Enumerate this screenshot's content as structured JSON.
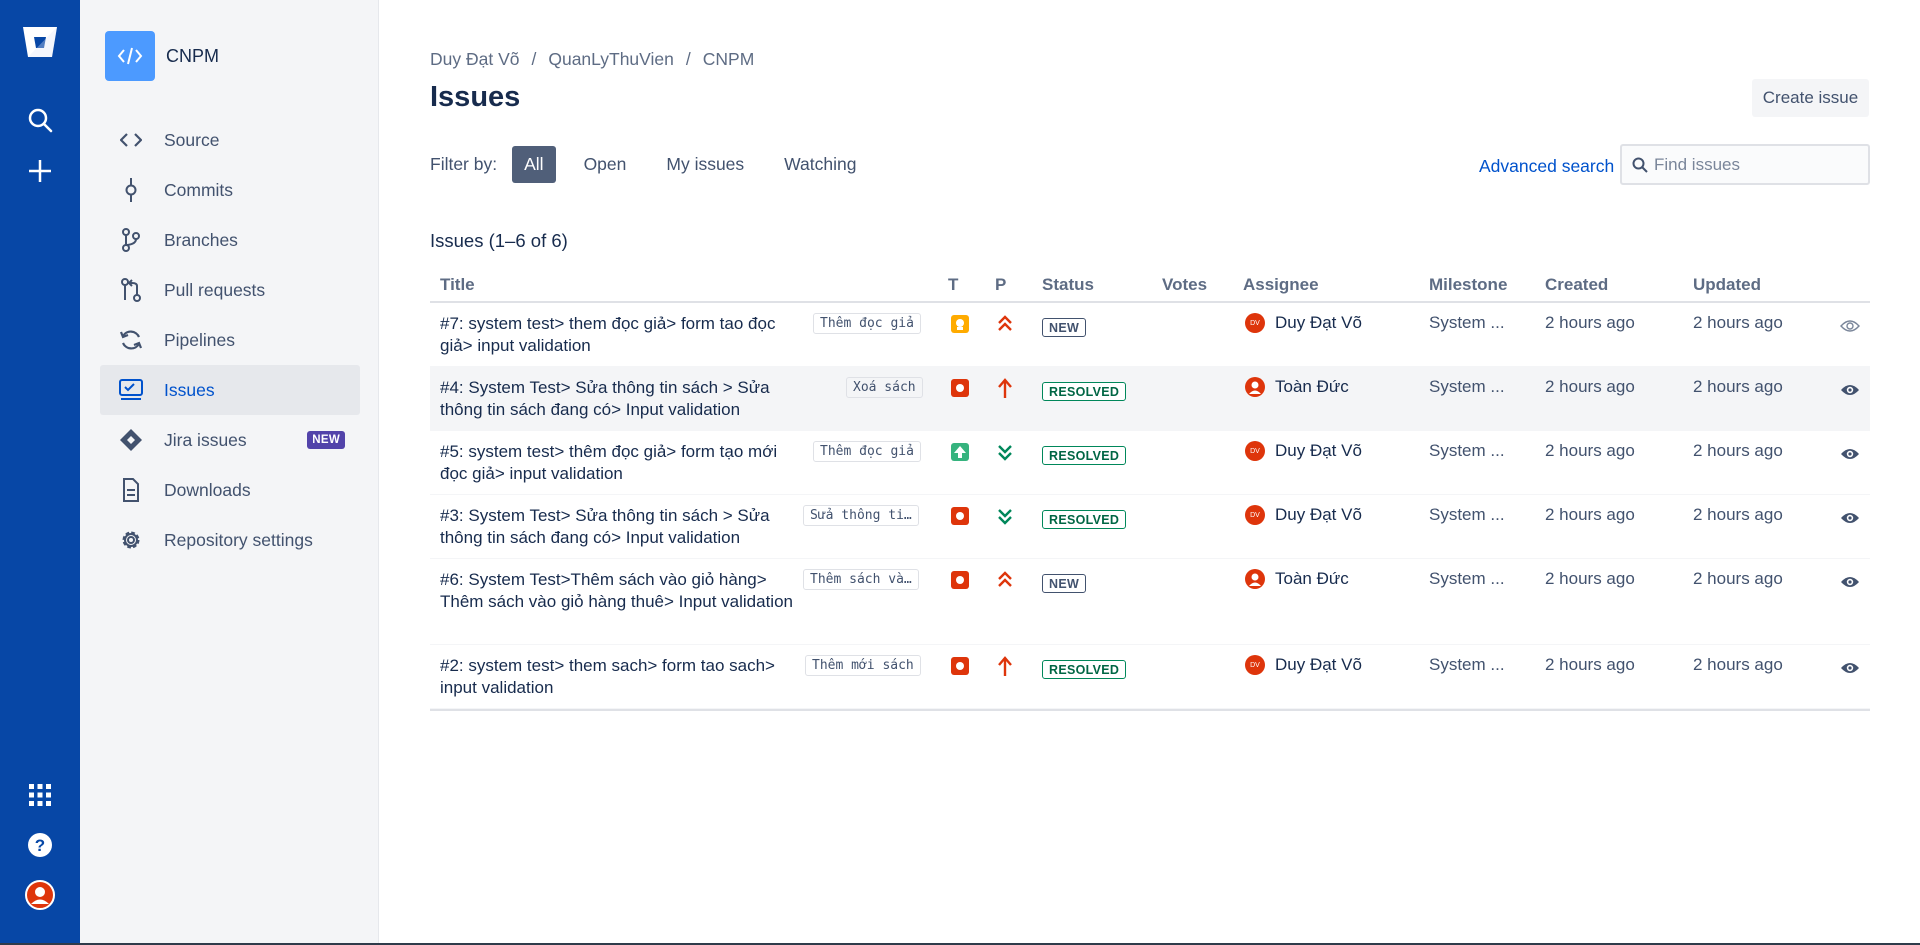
{
  "sidebar": {
    "project_name": "CNPM",
    "items": [
      {
        "label": "Source",
        "icon": "code-icon"
      },
      {
        "label": "Commits",
        "icon": "commit-icon"
      },
      {
        "label": "Branches",
        "icon": "branch-icon"
      },
      {
        "label": "Pull requests",
        "icon": "pull-request-icon"
      },
      {
        "label": "Pipelines",
        "icon": "pipelines-icon"
      },
      {
        "label": "Issues",
        "icon": "issues-icon",
        "active": true
      },
      {
        "label": "Jira issues",
        "icon": "jira-icon",
        "badge": "NEW"
      },
      {
        "label": "Downloads",
        "icon": "download-icon"
      },
      {
        "label": "Repository settings",
        "icon": "gear-icon"
      }
    ]
  },
  "breadcrumb": [
    "Duy Đạt Võ",
    "QuanLyThuVien",
    "CNPM"
  ],
  "breadcrumb_sep": "/",
  "page_title": "Issues",
  "create_issue_label": "Create issue",
  "filter": {
    "label": "Filter by:",
    "options": [
      "All",
      "Open",
      "My issues",
      "Watching"
    ],
    "selected": "All"
  },
  "advanced_search_label": "Advanced search",
  "search_placeholder": "Find issues",
  "issues_count": "Issues (1–6 of 6)",
  "columns": [
    "Title",
    "T",
    "P",
    "Status",
    "Votes",
    "Assignee",
    "Milestone",
    "Created",
    "Updated"
  ],
  "issues": [
    {
      "title": "#7: system test> them đọc giả> form tao đọc giả> input validation",
      "component": "Thêm đọc giả",
      "type": "task",
      "priority": "critical",
      "status": "NEW",
      "assignee": "Duy Đạt Võ",
      "assignee_initials": "DV",
      "milestone": "System ...",
      "created": "2 hours ago",
      "updated": "2 hours ago",
      "watching": false
    },
    {
      "title": "#4: System Test> Sửa thông tin sách > Sửa thông tin sách đang có> Input validation",
      "component": "Xoá sách",
      "type": "bug",
      "priority": "blocker",
      "status": "RESOLVED",
      "assignee": "Toàn Đức",
      "assignee_initials": "",
      "milestone": "System ...",
      "created": "2 hours ago",
      "updated": "2 hours ago",
      "watching": true
    },
    {
      "title": "#5: system test> thêm đọc giả> form tạo mới đọc giả> input validation",
      "component": "Thêm đọc giả",
      "type": "enhancement",
      "priority": "trivial",
      "status": "RESOLVED",
      "assignee": "Duy Đạt Võ",
      "assignee_initials": "DV",
      "milestone": "System ...",
      "created": "2 hours ago",
      "updated": "2 hours ago",
      "watching": true
    },
    {
      "title": "#3: System Test> Sửa thông tin sách > Sửa thông tin sách đang có> Input validation",
      "component": "Sửa thông ti…",
      "type": "bug",
      "priority": "trivial",
      "status": "RESOLVED",
      "assignee": "Duy Đạt Võ",
      "assignee_initials": "DV",
      "milestone": "System ...",
      "created": "2 hours ago",
      "updated": "2 hours ago",
      "watching": true
    },
    {
      "title": "#6: System Test>Thêm sách vào giỏ hàng> Thêm sách vào giỏ hàng thuê> Input validation",
      "component": "Thêm sách và…",
      "type": "bug",
      "priority": "critical",
      "status": "NEW",
      "assignee": "Toàn Đức",
      "assignee_initials": "",
      "milestone": "System ...",
      "created": "2 hours ago",
      "updated": "2 hours ago",
      "watching": true
    },
    {
      "title": "#2: system test> them sach> form tao sach> input validation",
      "component": "Thêm mới sách",
      "type": "bug",
      "priority": "blocker",
      "status": "RESOLVED",
      "assignee": "Duy Đạt Võ",
      "assignee_initials": "DV",
      "milestone": "System ...",
      "created": "2 hours ago",
      "updated": "2 hours ago",
      "watching": true
    }
  ],
  "colors": {
    "global_nav": "#0747a6",
    "link": "#0052cc",
    "resolved": "#00875a",
    "avatar": "#de350b"
  }
}
